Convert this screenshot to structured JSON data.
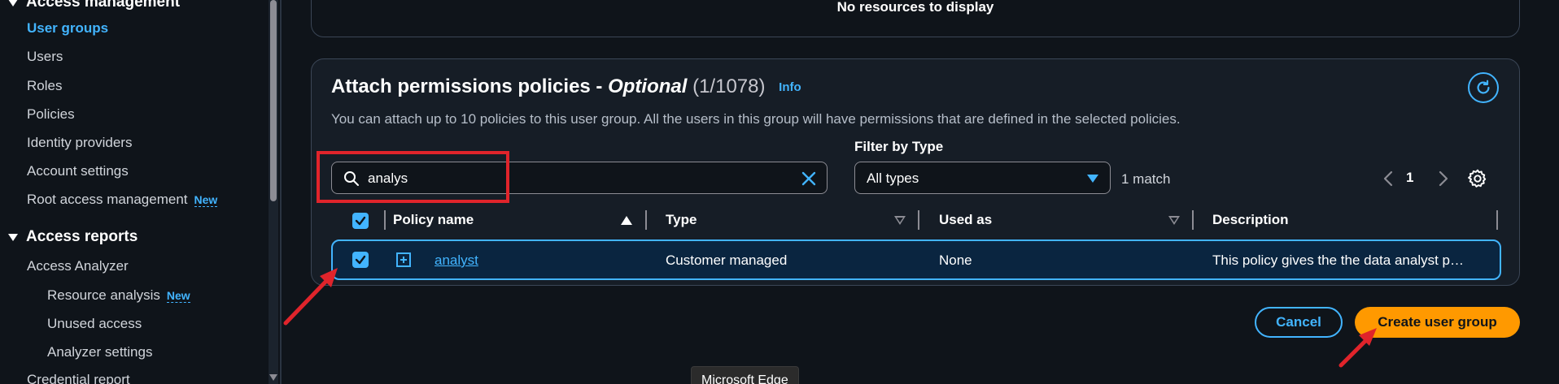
{
  "sidebar": {
    "access_management": "Access management",
    "items": [
      "User groups",
      "Users",
      "Roles",
      "Policies",
      "Identity providers",
      "Account settings"
    ],
    "root_access": "Root access management",
    "new_badge": "New",
    "access_reports": "Access reports",
    "access_analyzer": "Access Analyzer",
    "resource_analysis": "Resource analysis",
    "unused_access": "Unused access",
    "analyzer_settings": "Analyzer settings",
    "credential_report": "Credential report"
  },
  "top_card": {
    "empty_text": "No resources to display"
  },
  "policies_card": {
    "title": "Attach permissions policies - ",
    "title_optional": "Optional",
    "count": "(1/1078)",
    "info_link": "Info",
    "description": "You can attach up to 10 policies to this user group. All the users in this group will have permissions that are defined in the selected policies.",
    "search_value": "analys",
    "filter_label": "Filter by Type",
    "filter_value": "All types",
    "match_text": "1 match",
    "page_number": "1",
    "columns": [
      "Policy name",
      "Type",
      "Used as",
      "Description"
    ],
    "rows": [
      {
        "name": "analyst",
        "type": "Customer managed",
        "used_as": "None",
        "description": "This policy gives the the data analyst p…",
        "selected": true
      }
    ]
  },
  "actions": {
    "cancel": "Cancel",
    "create": "Create user group"
  },
  "tooltip": "Microsoft Edge",
  "colors": {
    "accent": "#42b4ff",
    "primary_button": "#ff9900",
    "annotation": "#e0242b",
    "background": "#0f141a"
  }
}
